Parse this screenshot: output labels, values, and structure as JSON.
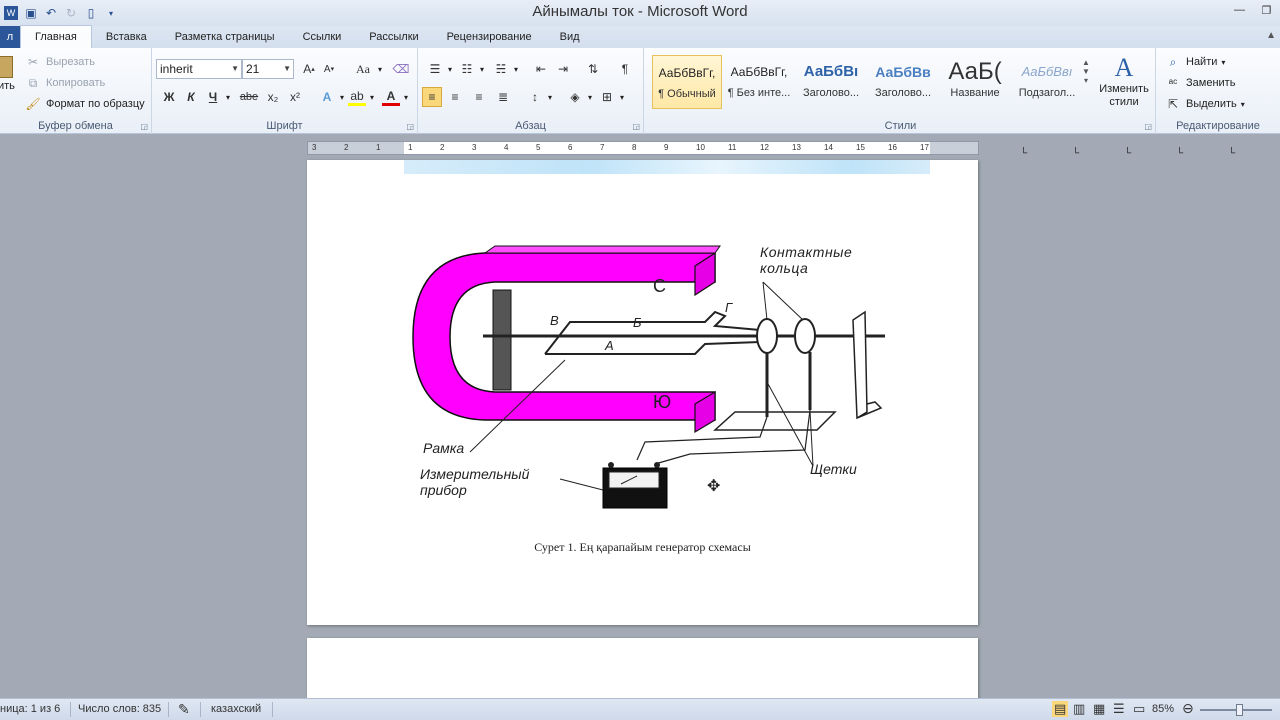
{
  "titlebar": {
    "title": "Айнымалы ток - Microsoft Word"
  },
  "tabs": [
    "Главная",
    "Вставка",
    "Разметка страницы",
    "Ссылки",
    "Рассылки",
    "Рецензирование",
    "Вид"
  ],
  "file_tab": "л",
  "clipboard": {
    "paste_fragment": "ить",
    "cut": "Вырезать",
    "copy": "Копировать",
    "format_painter": "Формат по образцу",
    "label": "Буфер обмена"
  },
  "font": {
    "name": "inherit",
    "size": "21",
    "label": "Шрифт",
    "bold": "Ж",
    "italic": "К",
    "underline": "Ч",
    "strike": "abe",
    "sub": "x₂",
    "sup": "x²",
    "case": "Aa"
  },
  "paragraph": {
    "label": "Абзац"
  },
  "styles": {
    "label": "Стили",
    "items": [
      {
        "sample": "АаБбВвГг,",
        "name": "¶ Обычный"
      },
      {
        "sample": "АаБбВвГг,",
        "name": "¶ Без инте..."
      },
      {
        "sample": "АаБбВı",
        "name": "Заголово..."
      },
      {
        "sample": "АаБбВв",
        "name": "Заголово..."
      },
      {
        "sample": "АаБ(",
        "name": "Название"
      },
      {
        "sample": "АаБбВвı",
        "name": "Подзагол..."
      }
    ],
    "change_styles": "Изменить стили"
  },
  "editing": {
    "find": "Найти",
    "replace": "Заменить",
    "select": "Выделить",
    "label": "Редактирование"
  },
  "ruler": {
    "numbers": [
      "3",
      "2",
      "1",
      "1",
      "2",
      "3",
      "4",
      "5",
      "6",
      "7",
      "8",
      "9",
      "10",
      "11",
      "12",
      "13",
      "14",
      "15",
      "16",
      "17"
    ]
  },
  "figure": {
    "labels": {
      "contact_rings": "Контактные кольца",
      "pole_n": "С",
      "pole_s": "Ю",
      "frame": "Рамка",
      "instrument": "Измерительный прибор",
      "brushes": "Щетки",
      "a": "А",
      "b": "Б",
      "v": "В",
      "g": "Г"
    },
    "magnet_color": "#ff00ff"
  },
  "caption": "Сурет 1. Ең қарапайым генератор схемасы",
  "status": {
    "page": "ница: 1 из 6",
    "words": "Число слов: 835",
    "language": "казахский",
    "zoom": "85%"
  }
}
